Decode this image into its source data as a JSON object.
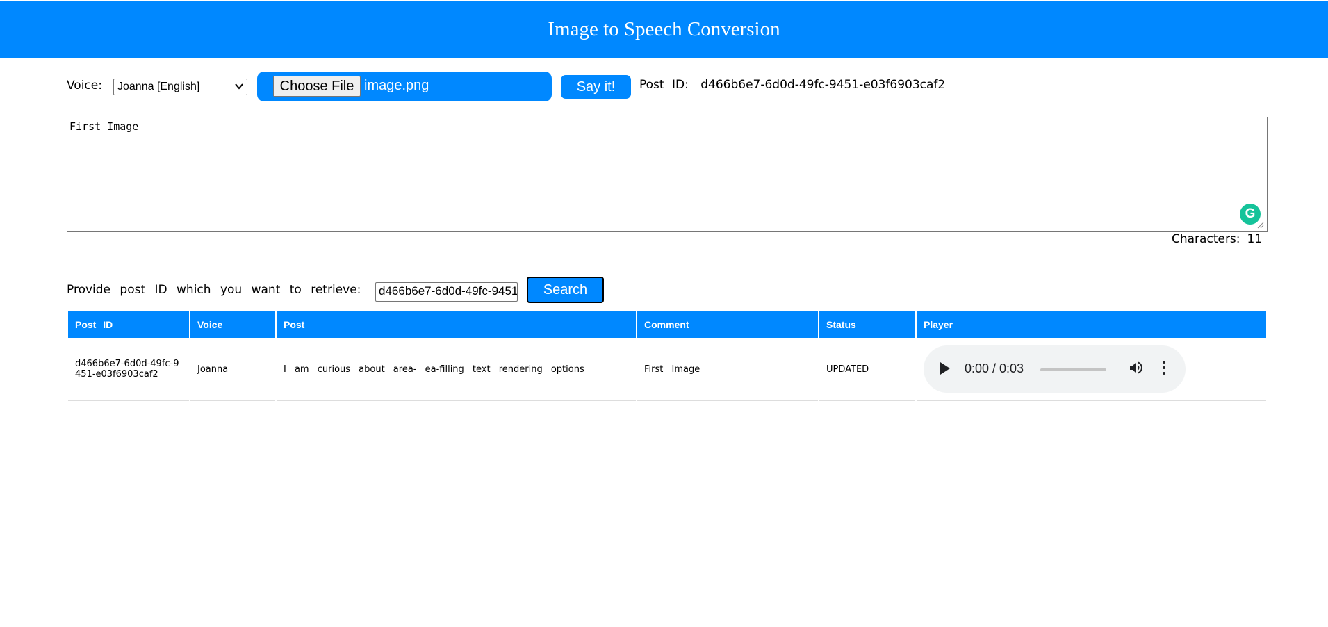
{
  "header": {
    "title": "Image to Speech Conversion"
  },
  "form": {
    "voice_label": "Voice:",
    "voice_selected": "Joanna [English]",
    "choose_file_label": "Choose File",
    "file_name": "image.png",
    "say_button": "Say it!",
    "post_id_label": "Post ID:",
    "post_id_value": "d466b6e7-6d0d-49fc-9451-e03f6903caf2",
    "text_value": "First Image",
    "characters_label": "Characters:",
    "characters_count": "11"
  },
  "retrieve": {
    "label": "Provide post ID which you want to retrieve:",
    "input_value": "d466b6e7-6d0d-49fc-9451",
    "search_button": "Search"
  },
  "table": {
    "headers": [
      "Post ID",
      "Voice",
      "Post",
      "Comment",
      "Status",
      "Player"
    ],
    "rows": [
      {
        "post_id": "d466b6e7-6d0d-49fc-9451-e03f6903caf2",
        "voice": "Joanna",
        "post": "I am curious about area- ea-filling text rendering options",
        "comment": "First Image",
        "status": "UPDATED",
        "player_time": "0:00 /  0:03"
      }
    ]
  },
  "icons": {
    "play": "play-icon",
    "volume": "volume-icon",
    "more": "more-vert-icon",
    "grammarly": "grammarly-icon"
  },
  "colors": {
    "accent": "#0088ff",
    "grammarly": "#15c39a"
  }
}
